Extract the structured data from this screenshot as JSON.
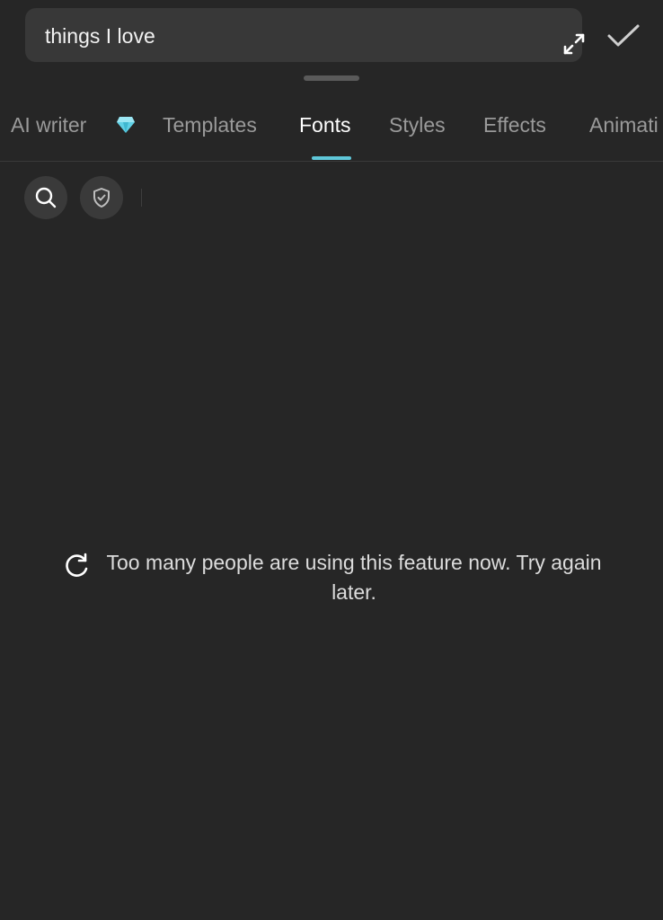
{
  "editor": {
    "text_value": "things I love"
  },
  "icons": {
    "expand": "expand-icon",
    "confirm": "checkmark-icon",
    "premium": "diamond-icon",
    "search": "search-icon",
    "shield": "shield-check-icon",
    "refresh": "refresh-icon"
  },
  "tabs": [
    {
      "label": "AI writer",
      "active": false,
      "premium": true
    },
    {
      "label": "Templates",
      "active": false
    },
    {
      "label": "Fonts",
      "active": true
    },
    {
      "label": "Styles",
      "active": false
    },
    {
      "label": "Effects",
      "active": false
    },
    {
      "label": "Animati",
      "active": false
    }
  ],
  "status": {
    "message": "Too many people are using this feature now. Try again later."
  },
  "colors": {
    "background": "#262626",
    "input_background": "#383838",
    "accent": "#5fc7d9",
    "diamond": "#5fd0e6",
    "inactive_tab": "#9a9a9a",
    "active_tab": "#ffffff"
  }
}
